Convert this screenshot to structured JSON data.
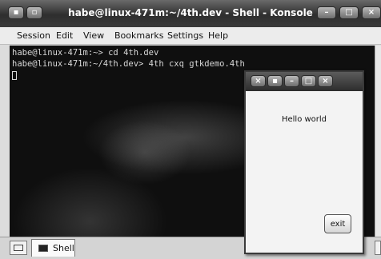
{
  "window": {
    "title": "habe@linux-471m:~/4th.dev - Shell - Konsole"
  },
  "menubar": {
    "items": [
      "Session",
      "Edit",
      "View",
      "Bookmarks",
      "Settings",
      "Help"
    ]
  },
  "terminal": {
    "lines": [
      "habe@linux-471m:~> cd 4th.dev",
      "habe@linux-471m:~/4th.dev> 4th cxq gtkdemo.4th"
    ]
  },
  "tabs": {
    "items": [
      {
        "label": "Shell"
      }
    ]
  },
  "dialog": {
    "label": "Hello world",
    "exit_button": "exit"
  }
}
